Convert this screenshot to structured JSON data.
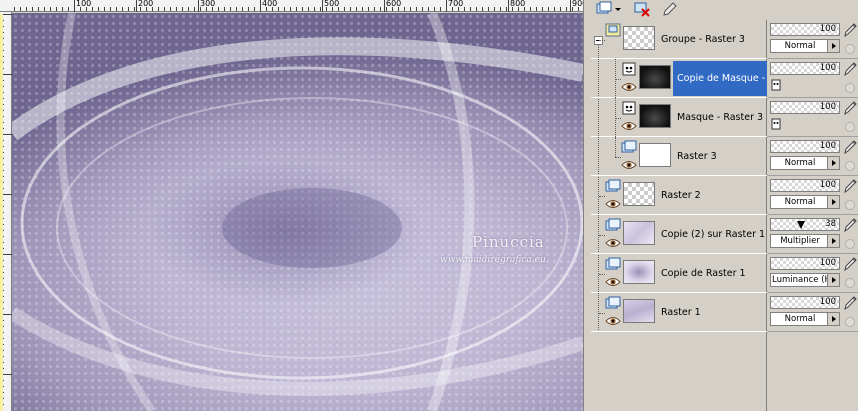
{
  "ruler": {
    "labels": [
      "100",
      "200",
      "300",
      "400",
      "500",
      "600",
      "700",
      "800",
      "900"
    ]
  },
  "watermark": {
    "title": "Pinuccia",
    "url": "www.maidiregrafica.eu"
  },
  "layers": [
    {
      "name": "Groupe - Raster 3",
      "type": "group-icon",
      "thumb": "checker",
      "eye": false
    },
    {
      "name": "Copie de Masque -",
      "type": "mask-icon",
      "thumb": "dark",
      "eye": true,
      "selected": true
    },
    {
      "name": "Masque - Raster 3",
      "type": "mask-icon",
      "thumb": "dark",
      "eye": true
    },
    {
      "name": "Raster 3",
      "type": "raster-icon",
      "thumb": "white",
      "eye": true
    },
    {
      "name": "Raster 2",
      "type": "raster-icon",
      "thumb": "checker",
      "eye": true
    },
    {
      "name": "Copie (2) sur Raster 1",
      "type": "raster-icon",
      "thumb": "lilac",
      "eye": true
    },
    {
      "name": "Copie de Raster 1",
      "type": "raster-icon",
      "thumb": "lilac2",
      "eye": true
    },
    {
      "name": "Raster 1",
      "type": "raster-icon",
      "thumb": "lilac3",
      "eye": true
    }
  ],
  "props": [
    {
      "opacity": "100",
      "blend": "Normal"
    },
    {
      "opacity": "100",
      "blend": ""
    },
    {
      "opacity": "100",
      "blend": ""
    },
    {
      "opacity": "100",
      "blend": "Normal"
    },
    {
      "opacity": "100",
      "blend": "Normal"
    },
    {
      "opacity": "38",
      "blend": "Multiplier",
      "slider": 0.38
    },
    {
      "opacity": "100",
      "blend": "Luminance (H)"
    },
    {
      "opacity": "100",
      "blend": "Normal"
    }
  ],
  "colors": {
    "selection": "#316ac5",
    "panel": "#d4d0c8"
  }
}
